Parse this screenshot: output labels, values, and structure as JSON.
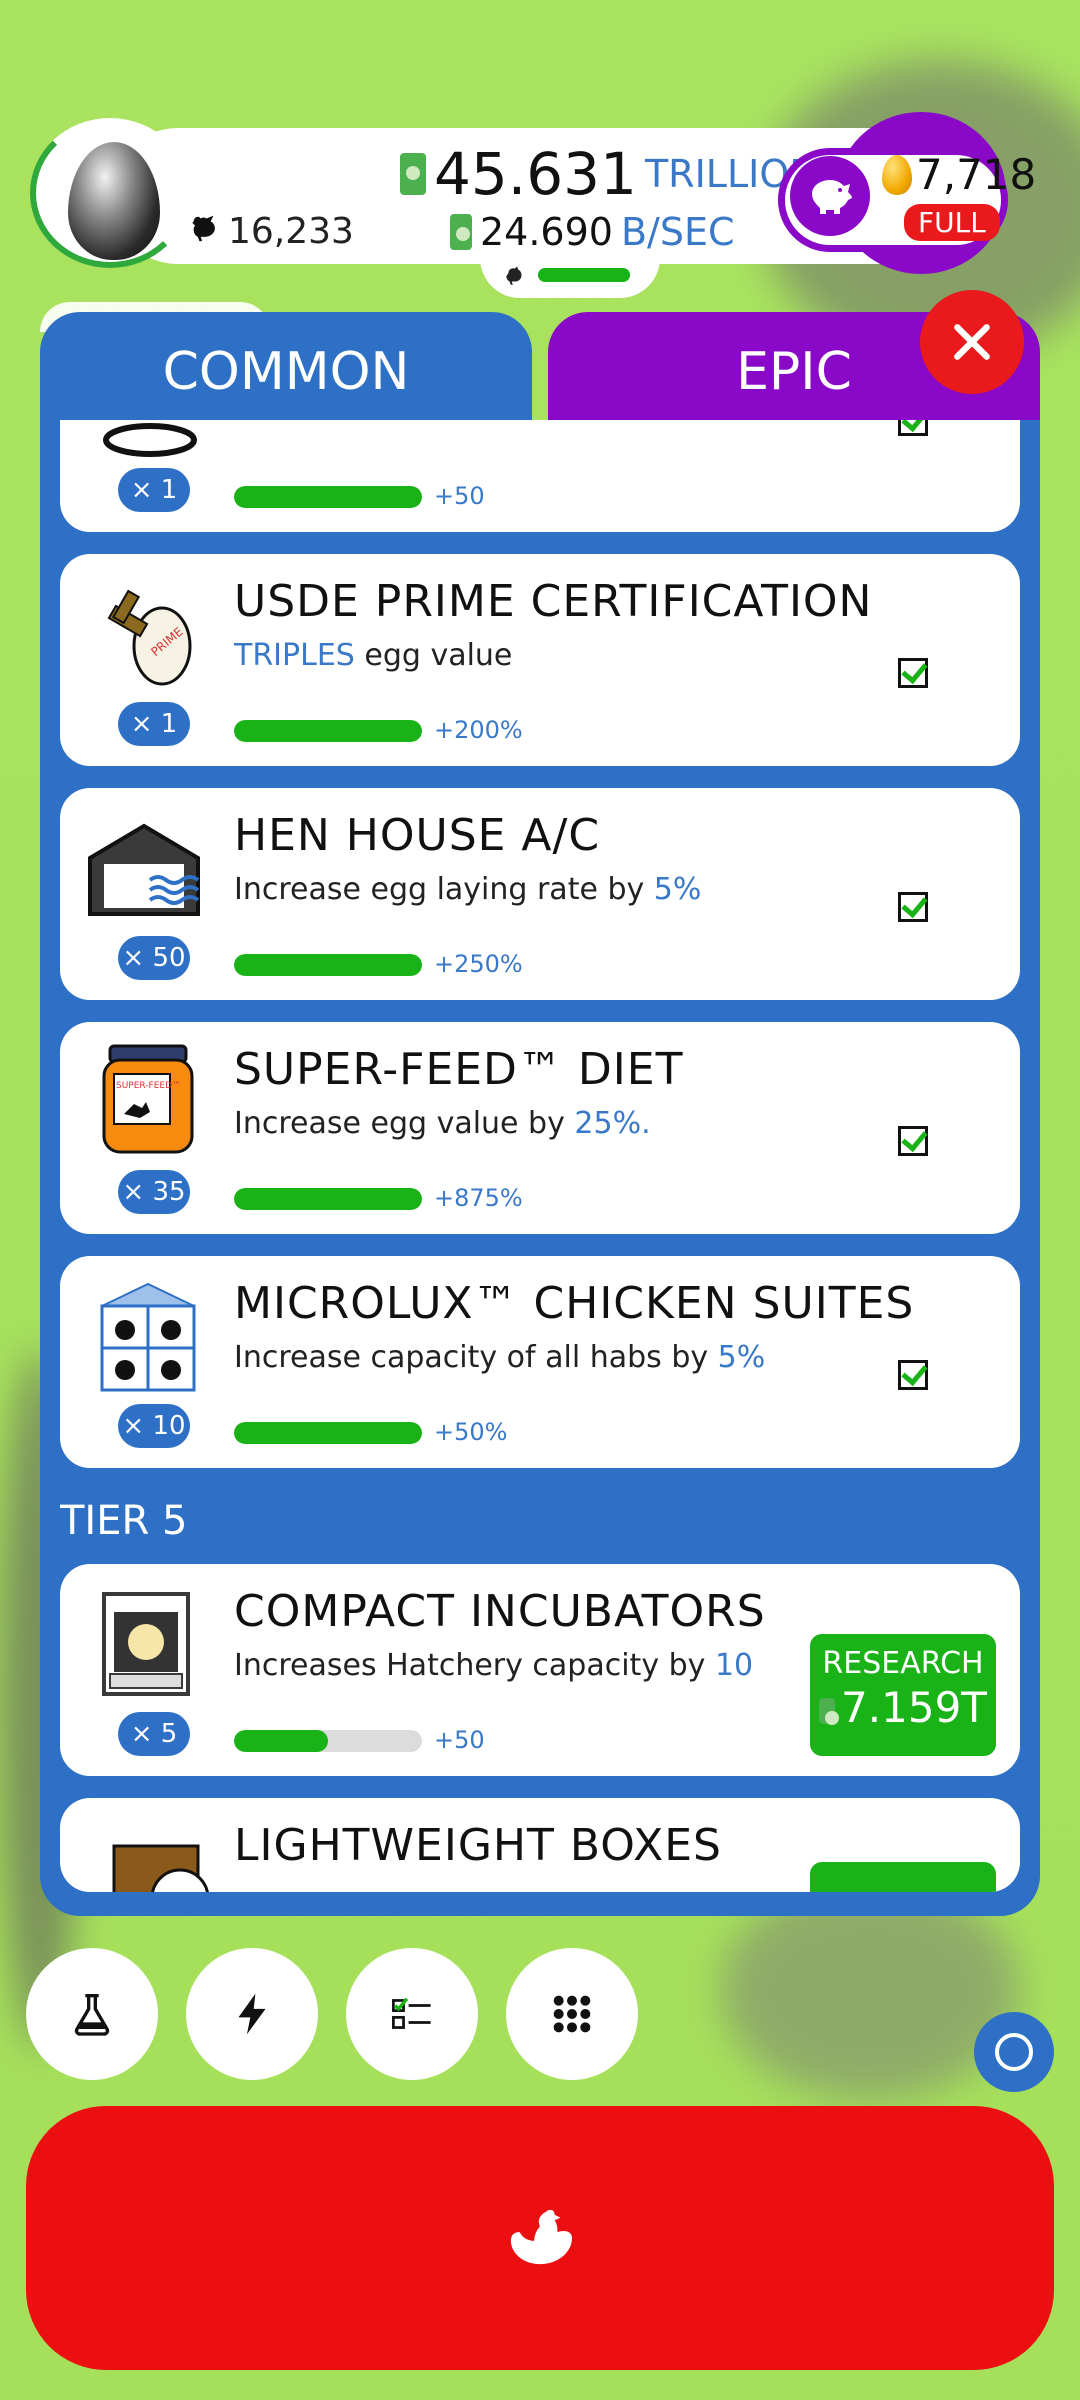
{
  "header": {
    "chicken_count": "16,233",
    "money_amount": "45.631",
    "money_unit": "TRILLION",
    "earning_rate": "24.690",
    "earning_rate_unit": "B/SEC",
    "golden_eggs": "7,718",
    "silo_status": "FULL"
  },
  "tabs": {
    "common": "COMMON",
    "epic": "EPIC"
  },
  "cards": [
    {
      "title": "",
      "desc_highlight": "",
      "desc_rest": "",
      "count": "× 1",
      "bonus": "+50",
      "progress": 1.0,
      "done": true
    },
    {
      "title": "USDE PRIME CERTIFICATION",
      "desc_highlight": "TRIPLES",
      "desc_rest": " egg value",
      "count": "× 1",
      "bonus": "+200%",
      "progress": 1.0,
      "done": true
    },
    {
      "title": "HEN HOUSE A/C",
      "desc_pre": "Increase egg laying rate by ",
      "desc_highlight": "5%",
      "count": "× 50",
      "bonus": "+250%",
      "progress": 1.0,
      "done": true
    },
    {
      "title": "SUPER-FEED™ DIET",
      "desc_pre": "Increase egg value by ",
      "desc_highlight": "25%",
      "desc_post": ".",
      "count": "× 35",
      "bonus": "+875%",
      "progress": 1.0,
      "done": true
    },
    {
      "title": "MICROLUX™ CHICKEN SUITES",
      "desc_pre": "Increase capacity of all habs by ",
      "desc_highlight": "5%",
      "count": "× 10",
      "bonus": "+50%",
      "progress": 1.0,
      "done": true
    },
    {
      "title": "COMPACT INCUBATORS",
      "desc_pre": "Increases Hatchery capacity by ",
      "desc_highlight": "10",
      "count": "× 5",
      "bonus": "+50",
      "progress": 0.5,
      "done": false,
      "research_label": "RESEARCH",
      "research_cost": "7.159T"
    },
    {
      "title": "LIGHTWEIGHT BOXES"
    }
  ],
  "tier_label": "TIER 5",
  "icons": {
    "chicken": "chicken-icon",
    "piggy": "piggy-bank-icon",
    "flask": "flask-icon",
    "bolt": "lightning-icon",
    "checklist": "checklist-icon",
    "grid": "grid-menu-icon",
    "close": "close-icon"
  },
  "colors": {
    "accent_blue": "#2d70c6",
    "epic_purple": "#8a08c8",
    "green": "#19b217",
    "red": "#ec0f12",
    "background": "#a6e05a"
  }
}
